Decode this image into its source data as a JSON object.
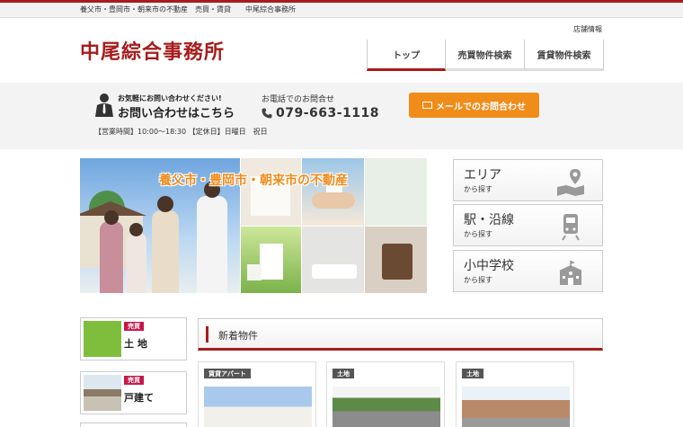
{
  "topbar": {
    "tagline": "養父市・豊岡市・朝来市の不動産　売買・賃貸　　中尾綜合事務所"
  },
  "header": {
    "store_info": "店舗情報",
    "logo": "中尾綜合事務所",
    "nav": [
      {
        "label": "トップ",
        "active": true
      },
      {
        "label": "売買物件検索",
        "active": false
      },
      {
        "label": "賃貸物件検索",
        "active": false
      }
    ]
  },
  "contact": {
    "small": "お気軽にお問い合わせください!",
    "big": "お問い合わせはこちら",
    "tel_label": "お電話でのお問合せ",
    "tel": "079-663-1118",
    "mail_button": "メールでのお問合わせ",
    "hours": "【営業時間】10:00～18:30 【定休日】日曜日　祝日"
  },
  "hero": {
    "caption": "養父市・豊岡市・朝来市の不動産"
  },
  "search": [
    {
      "title": "エリア",
      "sub": "から探す",
      "icon": "map-pin-icon"
    },
    {
      "title": "駅・沿線",
      "sub": "から探す",
      "icon": "train-icon"
    },
    {
      "title": "小中学校",
      "sub": "から探す",
      "icon": "school-icon"
    }
  ],
  "categories": [
    {
      "badge": "売買",
      "label": "土 地"
    },
    {
      "badge": "売買",
      "label": "戸建て"
    }
  ],
  "new_listings": {
    "title": "新着物件",
    "items": [
      {
        "badge": "賃貸アパート"
      },
      {
        "badge": "土地"
      },
      {
        "badge": "土地"
      }
    ]
  },
  "colors": {
    "brand": "#a61c1c",
    "accent": "#f08c1a",
    "badge": "#c8174a"
  }
}
